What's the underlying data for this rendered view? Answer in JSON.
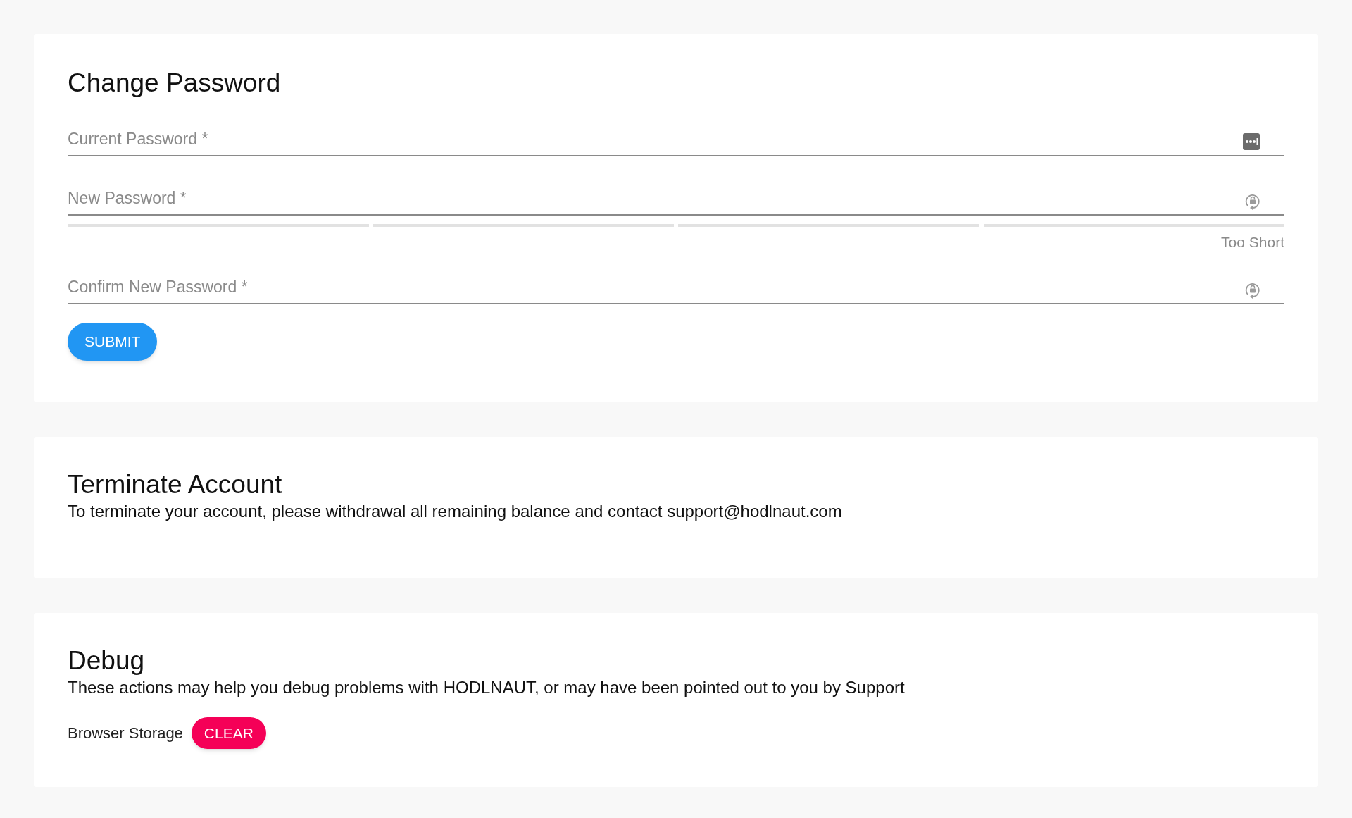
{
  "change_password": {
    "title": "Change Password",
    "fields": [
      {
        "label": "Current Password *",
        "kind": "current"
      },
      {
        "label": "New Password *",
        "kind": "new",
        "strength": {
          "level": 0,
          "reading": "Too Short"
        }
      },
      {
        "label": "Confirm New Password *",
        "kind": "new"
      }
    ],
    "submit_button": "SUBMIT"
  },
  "terminate_account": {
    "title": "Terminate Account",
    "text": "To terminate your account, please withdrawal all remaining balance and contact support@hodlnaut.com"
  },
  "debug": {
    "title": "Debug",
    "text": "These actions may help you debug problems with HODLNAUT, or may have been pointed out to you by Support",
    "actions": [
      {
        "label": "Browser Storage",
        "button": "CLEAR"
      }
    ]
  }
}
